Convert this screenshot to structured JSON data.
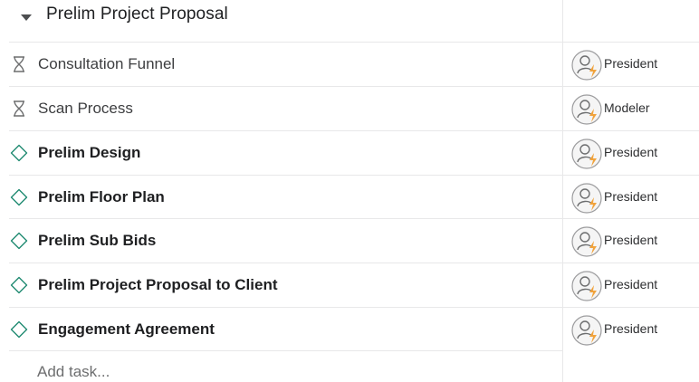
{
  "section": {
    "title": "Prelim Project Proposal",
    "toggle_icon": "caret-down-icon"
  },
  "tasks": [
    {
      "name": "Consultation Funnel",
      "type": "approval",
      "status_icon": "hourglass-icon",
      "assignee_role": "President",
      "avatar_icon": "placeholder-user-lightning-icon"
    },
    {
      "name": "Scan Process",
      "type": "approval",
      "status_icon": "hourglass-icon",
      "assignee_role": "Modeler",
      "avatar_icon": "placeholder-user-lightning-icon"
    },
    {
      "name": "Prelim Design",
      "type": "milestone",
      "status_icon": "diamond-icon",
      "assignee_role": "President",
      "avatar_icon": "placeholder-user-lightning-icon"
    },
    {
      "name": "Prelim Floor Plan",
      "type": "milestone",
      "status_icon": "diamond-icon",
      "assignee_role": "President",
      "avatar_icon": "placeholder-user-lightning-icon"
    },
    {
      "name": "Prelim Sub Bids",
      "type": "milestone",
      "status_icon": "diamond-icon",
      "assignee_role": "President",
      "avatar_icon": "placeholder-user-lightning-icon"
    },
    {
      "name": "Prelim Project Proposal to Client",
      "type": "milestone",
      "status_icon": "diamond-icon",
      "assignee_role": "President",
      "avatar_icon": "placeholder-user-lightning-icon"
    },
    {
      "name": "Engagement Agreement",
      "type": "milestone",
      "status_icon": "diamond-icon",
      "assignee_role": "President",
      "avatar_icon": "placeholder-user-lightning-icon"
    }
  ],
  "add_task": {
    "label": "Add task..."
  },
  "colors": {
    "milestone_icon": "#1f8a72",
    "approval_icon": "#6d6e6f",
    "lightning": "#f1a33c",
    "divider": "#e8e8e9"
  }
}
